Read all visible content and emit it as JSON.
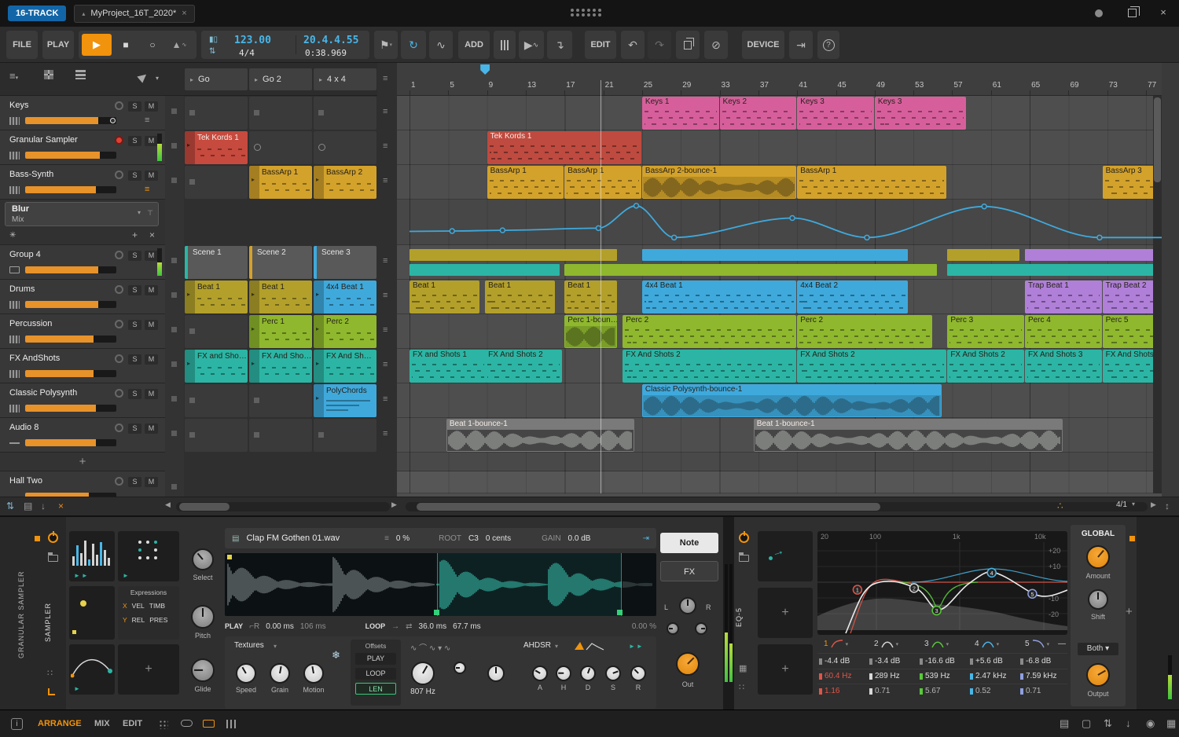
{
  "titlebar": {
    "badge": "16-TRACK",
    "tab_title": "MyProject_16T_2020*",
    "close": "×"
  },
  "toolbar": {
    "file": "FILE",
    "play": "PLAY",
    "add": "ADD",
    "edit": "EDIT",
    "device": "DEVICE",
    "tempo": "123.00",
    "timesig": "4/4",
    "position": "20.4.4.55",
    "time": "0:38.969"
  },
  "view": {
    "zoom": "4/1"
  },
  "labels": {
    "solo": "S",
    "mute": "M",
    "add_track": "+"
  },
  "scenes": [
    "Go",
    "Go 2",
    "4 x 4"
  ],
  "ruler_ticks": [
    1,
    5,
    9,
    13,
    17,
    21,
    25,
    29,
    33,
    37,
    41,
    45,
    49,
    53,
    57,
    61,
    65,
    69,
    73,
    77
  ],
  "playhead_bar": 20.7,
  "marker_bar": 8.8,
  "fx_track": {
    "name": "Hall Two"
  },
  "tracks": [
    {
      "name": "Keys",
      "icon": "inst",
      "vol": 0.8,
      "dot": true,
      "menu": true,
      "slots": [
        {
          "kind": "empty"
        },
        {
          "kind": "empty"
        },
        {
          "kind": "empty"
        }
      ],
      "arr": [
        {
          "label": "Keys 1",
          "start": 25,
          "len": 8,
          "color": "#d65f9b",
          "pat": "notes"
        },
        {
          "label": "Keys 2",
          "start": 33,
          "len": 8,
          "color": "#d65f9b",
          "pat": "notes"
        },
        {
          "label": "Keys 3",
          "start": 41,
          "len": 8,
          "color": "#d65f9b",
          "pat": "notes"
        },
        {
          "label": "Keys 3",
          "start": 49,
          "len": 9.5,
          "color": "#d65f9b",
          "pat": "notes"
        }
      ]
    },
    {
      "name": "Granular Sampler",
      "icon": "inst",
      "vol": 0.82,
      "armed": true,
      "meter": 0.62,
      "slots": [
        {
          "kind": "clip",
          "label": "Tek Kords 1",
          "color": "#c64a3e",
          "light": true
        },
        {
          "kind": "circle"
        },
        {
          "kind": "circle"
        }
      ],
      "arr": [
        {
          "label": "Tek Kords 1",
          "start": 9,
          "len": 16,
          "color": "#bf4a3f",
          "pat": "notes",
          "light": true
        }
      ]
    },
    {
      "name": "Bass-Synth",
      "icon": "inst",
      "vol": 0.78,
      "menu_orange": true,
      "expand": {
        "plugin": "Blur",
        "param": "Mix",
        "add": "+",
        "close": "×"
      },
      "slots": [
        {
          "kind": "empty"
        },
        {
          "kind": "clip",
          "label": "BassArp 1",
          "color": "#d3a22b"
        },
        {
          "kind": "clip",
          "label": "BassArp 2",
          "color": "#d3a22b"
        }
      ],
      "arr": [
        {
          "label": "BassArp 1",
          "start": 9,
          "len": 8,
          "color": "#d3a22b",
          "pat": "notes"
        },
        {
          "label": "BassArp 1",
          "start": 17,
          "len": 8,
          "color": "#d3a22b",
          "pat": "notes"
        },
        {
          "label": "BassArp 2-bounce-1",
          "start": 25,
          "len": 16,
          "color": "#d3a22b",
          "pat": "wave"
        },
        {
          "label": "BassArp 1",
          "start": 41,
          "len": 15.5,
          "color": "#d3a22b",
          "pat": "notes"
        },
        {
          "label": "BassArp 3",
          "start": 72.5,
          "len": 6,
          "color": "#d3a22b",
          "pat": "notes"
        }
      ]
    },
    {
      "name": "Group 4",
      "icon": "group",
      "vol": 0.8,
      "meter": 0.5,
      "slots": [
        {
          "kind": "scene",
          "label": "Scene 1",
          "edge": "#2cb5a4"
        },
        {
          "kind": "scene",
          "label": "Scene 2",
          "edge": "#d3a22b"
        },
        {
          "kind": "scene",
          "label": "Scene 3",
          "edge": "#3fa9dc"
        }
      ],
      "segments": {
        "top": [
          {
            "start": 1,
            "len": 21.5,
            "color": "#b3a02b"
          },
          {
            "start": 25,
            "len": 27.5,
            "color": "#3fa9dc"
          },
          {
            "start": 56.5,
            "len": 7.5,
            "color": "#b3a02b"
          },
          {
            "start": 64.5,
            "len": 14,
            "color": "#b07fd8"
          }
        ],
        "bottom": [
          {
            "start": 1,
            "len": 15.6,
            "color": "#2cb5a4"
          },
          {
            "start": 17,
            "len": 38.5,
            "color": "#8fb82e"
          },
          {
            "start": 56.5,
            "len": 22,
            "color": "#2cb5a4"
          }
        ]
      }
    },
    {
      "name": "Drums",
      "icon": "inst",
      "vol": 0.8,
      "slots": [
        {
          "kind": "clip",
          "label": "Beat 1",
          "color": "#b3a02b"
        },
        {
          "kind": "clip",
          "label": "Beat 1",
          "color": "#b3a02b"
        },
        {
          "kind": "clip",
          "label": "4x4 Beat 1",
          "color": "#3fa9dc"
        }
      ],
      "arr": [
        {
          "label": "Beat 1",
          "start": 1,
          "len": 7.3,
          "color": "#b3a02b",
          "pat": "notes"
        },
        {
          "label": "Beat 1",
          "start": 8.8,
          "len": 7.3,
          "color": "#b3a02b",
          "pat": "notes"
        },
        {
          "label": "Beat 1",
          "start": 17,
          "len": 5.5,
          "color": "#b3a02b",
          "pat": "notes"
        },
        {
          "label": "4x4 Beat 1",
          "start": 25,
          "len": 16,
          "color": "#3fa9dc",
          "pat": "notes"
        },
        {
          "label": "4x4 Beat 2",
          "start": 41,
          "len": 11.5,
          "color": "#3fa9dc",
          "pat": "notes"
        },
        {
          "label": "Trap Beat 1",
          "start": 64.5,
          "len": 8,
          "color": "#b07fd8",
          "pat": "notes"
        },
        {
          "label": "Trap Beat 2",
          "start": 72.5,
          "len": 6,
          "color": "#b07fd8",
          "pat": "notes"
        }
      ]
    },
    {
      "name": "Percussion",
      "icon": "inst",
      "vol": 0.75,
      "slots": [
        {
          "kind": "empty"
        },
        {
          "kind": "clip",
          "label": "Perc 1",
          "color": "#8fb82e"
        },
        {
          "kind": "clip",
          "label": "Perc 2",
          "color": "#8fb82e"
        }
      ],
      "arr": [
        {
          "label": "Perc 1-boun…",
          "start": 17,
          "len": 5.5,
          "color": "#8fb82e",
          "pat": "wave"
        },
        {
          "label": "Perc 2",
          "start": 23,
          "len": 18,
          "color": "#8fb82e",
          "pat": "notes"
        },
        {
          "label": "Perc 2",
          "start": 41,
          "len": 14,
          "color": "#8fb82e",
          "pat": "notes"
        },
        {
          "label": "Perc 3",
          "start": 56.5,
          "len": 8,
          "color": "#8fb82e",
          "pat": "notes"
        },
        {
          "label": "Perc 4",
          "start": 64.5,
          "len": 8,
          "color": "#8fb82e",
          "pat": "notes"
        },
        {
          "label": "Perc 5",
          "start": 72.5,
          "len": 6,
          "color": "#8fb82e",
          "pat": "notes"
        }
      ]
    },
    {
      "name": "FX AndShots",
      "icon": "inst",
      "vol": 0.75,
      "slots": [
        {
          "kind": "clip",
          "label": "FX and Sho…",
          "color": "#2cb5a4"
        },
        {
          "kind": "clip",
          "label": "FX And Sho…",
          "color": "#2cb5a4"
        },
        {
          "kind": "clip",
          "label": "FX And Sh…",
          "color": "#2cb5a4"
        }
      ],
      "arr": [
        {
          "label": "FX and Shots 1",
          "start": 1,
          "len": 8,
          "color": "#2cb5a4",
          "pat": "notes"
        },
        {
          "label": "FX And Shots 2",
          "start": 8.8,
          "len": 8,
          "color": "#2cb5a4",
          "pat": "notes"
        },
        {
          "label": "FX And Shots 2",
          "start": 23,
          "len": 18,
          "color": "#2cb5a4",
          "pat": "notes"
        },
        {
          "label": "FX And Shots 2",
          "start": 41,
          "len": 15.5,
          "color": "#2cb5a4",
          "pat": "notes"
        },
        {
          "label": "FX And Shots 2",
          "start": 56.5,
          "len": 8,
          "color": "#2cb5a4",
          "pat": "notes"
        },
        {
          "label": "FX And Shots 3",
          "start": 64.5,
          "len": 8,
          "color": "#2cb5a4",
          "pat": "notes"
        },
        {
          "label": "FX And Shots",
          "start": 72.5,
          "len": 6,
          "color": "#2cb5a4",
          "pat": "notes"
        }
      ]
    },
    {
      "name": "Classic Polysynth",
      "icon": "inst",
      "vol": 0.78,
      "slots": [
        {
          "kind": "empty"
        },
        {
          "kind": "empty"
        },
        {
          "kind": "clip",
          "label": "PolyChords",
          "color": "#3fa9dc",
          "pat": "lines"
        }
      ],
      "arr": [
        {
          "label": "Classic Polysynth-bounce-1",
          "start": 25,
          "len": 31,
          "color": "#3fa9dc",
          "pat": "wave"
        }
      ]
    },
    {
      "name": "Audio 8",
      "icon": "audio",
      "vol": 0.78,
      "slots": [
        {
          "kind": "empty"
        },
        {
          "kind": "empty"
        },
        {
          "kind": "empty"
        }
      ],
      "arr": [
        {
          "label": "Beat 1-bounce-1",
          "start": 4.8,
          "len": 19.5,
          "color": "#7a7a7a",
          "pat": "audio",
          "light": true
        },
        {
          "label": "Beat 1-bounce-1",
          "start": 36.5,
          "len": 32,
          "color": "#7a7a7a",
          "pat": "audio",
          "light": true
        }
      ]
    }
  ],
  "automation": {
    "points": [
      [
        1,
        0.25
      ],
      [
        5.4,
        0.26
      ],
      [
        10.6,
        0.28
      ],
      [
        20.5,
        0.34
      ],
      [
        24.4,
        0.96
      ],
      [
        28.3,
        0.08
      ],
      [
        40.5,
        0.62
      ],
      [
        48.2,
        0.08
      ],
      [
        60.3,
        0.94
      ],
      [
        72.2,
        0.08
      ],
      [
        79.5,
        0.08
      ]
    ]
  },
  "device": {
    "chain_label": "GRANULAR SAMPLER",
    "sampler": {
      "tab": "SAMPLER",
      "file": "Clap FM Gothen 01.wav",
      "stretch": "0 %",
      "root_label": "ROOT",
      "root": "C3",
      "tune": "0 cents",
      "gain_label": "GAIN",
      "gain": "0.0 dB",
      "play_label": "PLAY",
      "play_start": "0.00 ms",
      "play_len": "106 ms",
      "loop_label": "LOOP",
      "loop_start": "36.0 ms",
      "loop_len": "67.7 ms",
      "loop_fade": "0.00 %",
      "select": "Select",
      "pitch": "Pitch",
      "glide": "Glide",
      "textures": "Textures",
      "tex_knobs": [
        "Speed",
        "Grain",
        "Motion"
      ],
      "offsets_label": "Offsets",
      "offsets": [
        "PLAY",
        "LOOP",
        "LEN"
      ],
      "filter_value": "807 Hz",
      "env_label": "AHDSR",
      "env_knobs": [
        "A",
        "H",
        "D",
        "S",
        "R"
      ],
      "note": "Note",
      "fx": "FX",
      "pan_l": "L",
      "pan_r": "R",
      "out": "Out"
    },
    "expressions": {
      "title": "Expressions",
      "x": "X",
      "y": "Y",
      "row1": [
        "VEL",
        "TIMB"
      ],
      "row2": [
        "REL",
        "PRES"
      ]
    },
    "eq": {
      "tab": "EQ-5",
      "global": "GLOBAL",
      "amount": "Amount",
      "shift": "Shift",
      "mode": "Both",
      "output": "Output",
      "freq_labels": [
        "20",
        "100",
        "1k",
        "10k"
      ],
      "db_labels": [
        "+20",
        "+10",
        "-10",
        "-20"
      ],
      "bands": [
        {
          "n": "1",
          "type": "lowcut",
          "color": "#e05548",
          "gain": "-4.4 dB",
          "freq": "60.4 Hz",
          "q": "1.16",
          "freq_hz": 60.4,
          "gain_db": -4.4,
          "selected": true
        },
        {
          "n": "2",
          "type": "bell",
          "color": "#d8d8d8",
          "gain": "-3.4 dB",
          "freq": "289 Hz",
          "q": "0.71",
          "freq_hz": 289,
          "gain_db": -3.4
        },
        {
          "n": "3",
          "type": "bell",
          "color": "#59c939",
          "gain": "-16.6 dB",
          "freq": "539 Hz",
          "q": "5.67",
          "freq_hz": 539,
          "gain_db": -16.6
        },
        {
          "n": "4",
          "type": "bell",
          "color": "#49b6e8",
          "gain": "+5.6 dB",
          "freq": "2.47 kHz",
          "q": "0.52",
          "freq_hz": 2470,
          "gain_db": 5.6
        },
        {
          "n": "5",
          "type": "highcut",
          "color": "#8fa0e0",
          "gain": "-6.8 dB",
          "freq": "7.59 kHz",
          "q": "0.71",
          "freq_hz": 7590,
          "gain_db": -6.8
        }
      ]
    }
  },
  "statusbar": {
    "info": "i",
    "tabs": [
      "ARRANGE",
      "MIX",
      "EDIT"
    ],
    "active": "ARRANGE"
  }
}
